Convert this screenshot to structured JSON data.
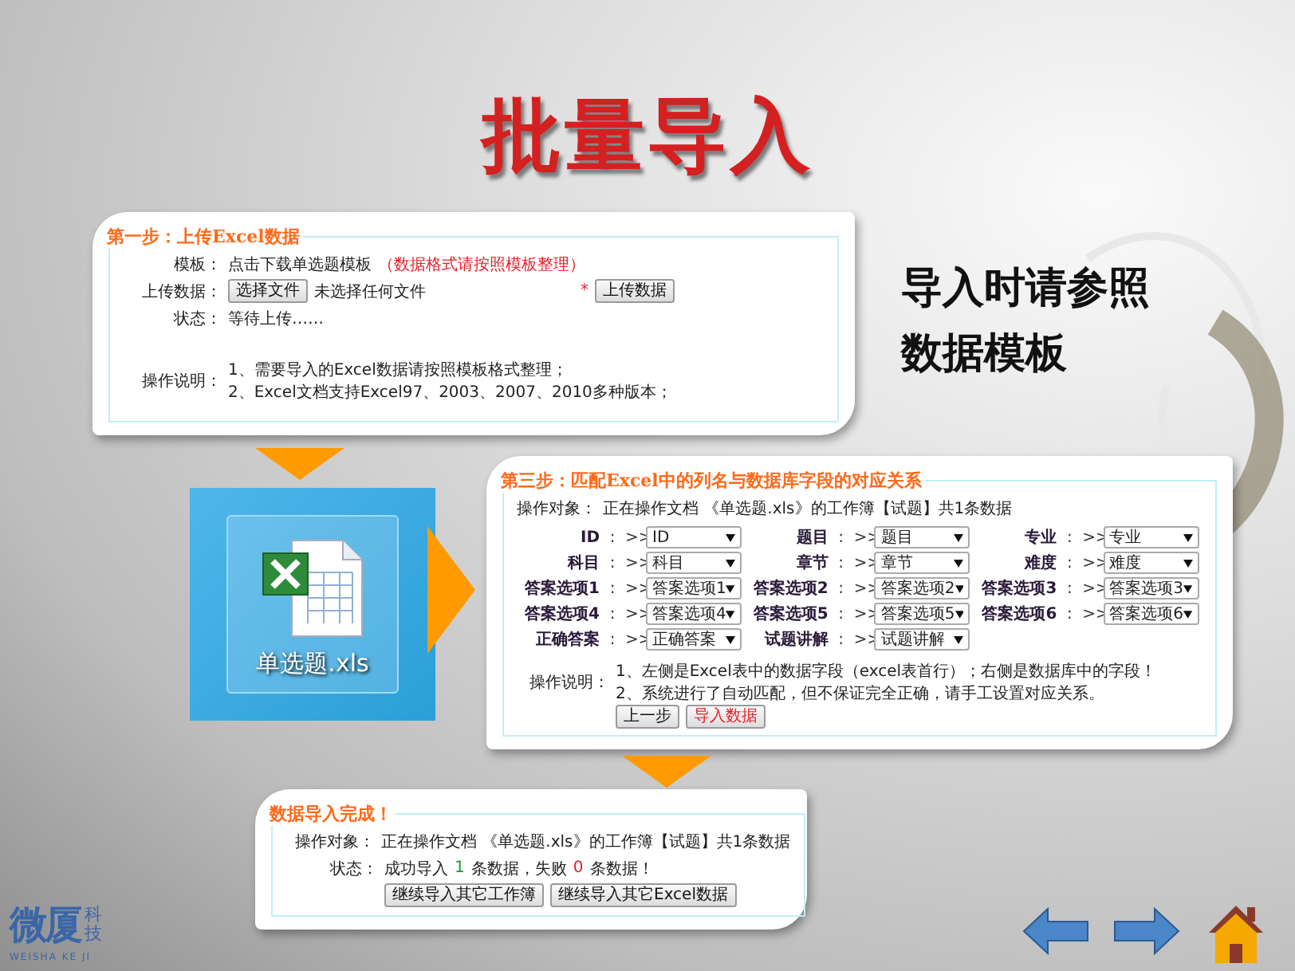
{
  "title": "批量导入",
  "note_lines": [
    "导入时请参照",
    "数据模板"
  ],
  "step1": {
    "legend": "第一步：上传Excel数据",
    "template": {
      "label": "模板：",
      "link": "点击下载单选题模板",
      "hint": "（数据格式请按照模板整理）"
    },
    "upload": {
      "label": "上传数据：",
      "file_button": "选择文件",
      "file_status": "未选择任何文件",
      "required_mark": "*",
      "submit": "上传数据"
    },
    "status": {
      "label": "状态：",
      "value": "等待上传……"
    },
    "instructions": {
      "label": "操作说明：",
      "lines": [
        "1、需要导入的Excel数据请按照模板格式整理；",
        "2、Excel文档支持Excel97、2003、2007、2010多种版本；"
      ]
    }
  },
  "file_tile": {
    "label": "单选题.xls"
  },
  "step3": {
    "legend": "第三步：匹配Excel中的列名与数据库字段的对应关系",
    "target": {
      "label": "操作对象：",
      "value": "正在操作文档 《单选题.xls》的工作簿【试题】共1条数据"
    },
    "mappings": [
      {
        "field": "ID",
        "value": "ID"
      },
      {
        "field": "题目",
        "value": "题目"
      },
      {
        "field": "专业",
        "value": "专业"
      },
      {
        "field": "科目",
        "value": "科目"
      },
      {
        "field": "章节",
        "value": "章节"
      },
      {
        "field": "难度",
        "value": "难度"
      },
      {
        "field": "答案选项1",
        "value": "答案选项1"
      },
      {
        "field": "答案选项2",
        "value": "答案选项2"
      },
      {
        "field": "答案选项3",
        "value": "答案选项3"
      },
      {
        "field": "答案选项4",
        "value": "答案选项4"
      },
      {
        "field": "答案选项5",
        "value": "答案选项5"
      },
      {
        "field": "答案选项6",
        "value": "答案选项6"
      },
      {
        "field": "正确答案",
        "value": "正确答案"
      },
      {
        "field": "试题讲解",
        "value": "试题讲解"
      }
    ],
    "separator": ":",
    "arrow": ">>",
    "instructions": {
      "label": "操作说明：",
      "lines": [
        "1、左侧是Excel表中的数据字段（excel表首行）；右侧是数据库中的字段！",
        "2、系统进行了自动匹配，但不保证完全正确，请手工设置对应关系。"
      ]
    },
    "buttons": [
      {
        "label": "上一步",
        "kind": "normal"
      },
      {
        "label": "导入数据",
        "kind": "primary"
      }
    ]
  },
  "done": {
    "legend": "数据导入完成！",
    "target": {
      "label": "操作对象：",
      "value": "正在操作文档 《单选题.xls》的工作簿【试题】共1条数据"
    },
    "status": {
      "label": "状态：",
      "prefix": "成功导入",
      "success": "1",
      "middle": "条数据，失败",
      "failed": "0",
      "suffix": "条数据！"
    },
    "buttons": [
      "继续导入其它工作簿",
      "继续导入其它Excel数据"
    ]
  },
  "logo": {
    "mark": "微厦",
    "side": "科技",
    "caption": "WEISHA KE JI"
  }
}
